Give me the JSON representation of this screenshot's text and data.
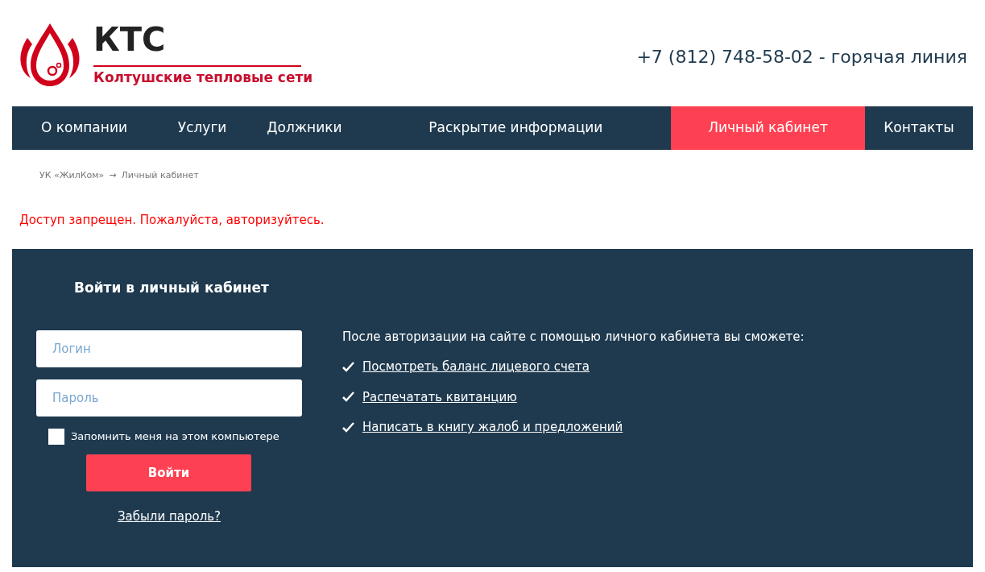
{
  "logo": {
    "name": "КТС",
    "subtitle": "Колтушские тепловые сети"
  },
  "phone": "+7 (812) 748-58-02 - горячая линия",
  "nav": [
    {
      "label": "О компании",
      "selected": false
    },
    {
      "label": "Услуги",
      "selected": false
    },
    {
      "label": "Должники",
      "selected": false
    },
    {
      "label": "Раскрытие информации",
      "selected": false
    },
    {
      "label": "Личный кабинет",
      "selected": true
    },
    {
      "label": "Контакты",
      "selected": false
    }
  ],
  "breadcrumb": {
    "items": [
      "УК «ЖилКом»",
      "Личный кабинет"
    ],
    "separator": "→"
  },
  "error": "Доступ запрещен. Пожалуйста, авторизуйтесь.",
  "login": {
    "title": "Войти в личный кабинет",
    "login_field": {
      "placeholder": "Логин"
    },
    "password_field": {
      "placeholder": "Пароль"
    },
    "remember": {
      "label": "Запомнить меня на этом компьютере",
      "checked": false
    },
    "submit": "Войти",
    "forgot": "Забыли пароль?"
  },
  "benefits": {
    "intro": "После авторизации на сайте с помощью личного кабинета вы сможете:",
    "links": [
      "Посмотреть баланс лицевого счета",
      "Распечатать квитанцию",
      "Написать в книгу жалоб и предложений"
    ]
  }
}
